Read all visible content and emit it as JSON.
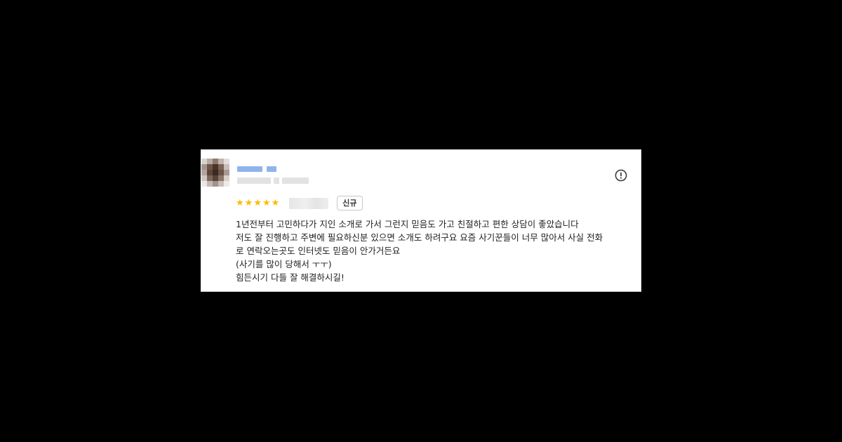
{
  "review": {
    "reviewer_name": "",
    "rating": 5,
    "rating_max": 5,
    "star_icon": "star-icon",
    "badge": "신규",
    "report_icon": "report-icon",
    "star_color": "#fbbc04",
    "lines": [
      "1년전부터 고민하다가 지인 소개로 가서 그런지 믿음도 가고 친절하고 편한 상담이 좋았습니다",
      "저도 잘 진행하고 주변에 필요하신분 있으면 소개도 하려구요 요즘 사기꾼들이 너무 많아서 사실 전화",
      "로 연락오는곳도 인터넷도 믿음이 안가거든요",
      "(사기를 많이 당해서 ㅜㅜ)",
      "힘든시기 다들 잘 해결하시길!"
    ]
  }
}
